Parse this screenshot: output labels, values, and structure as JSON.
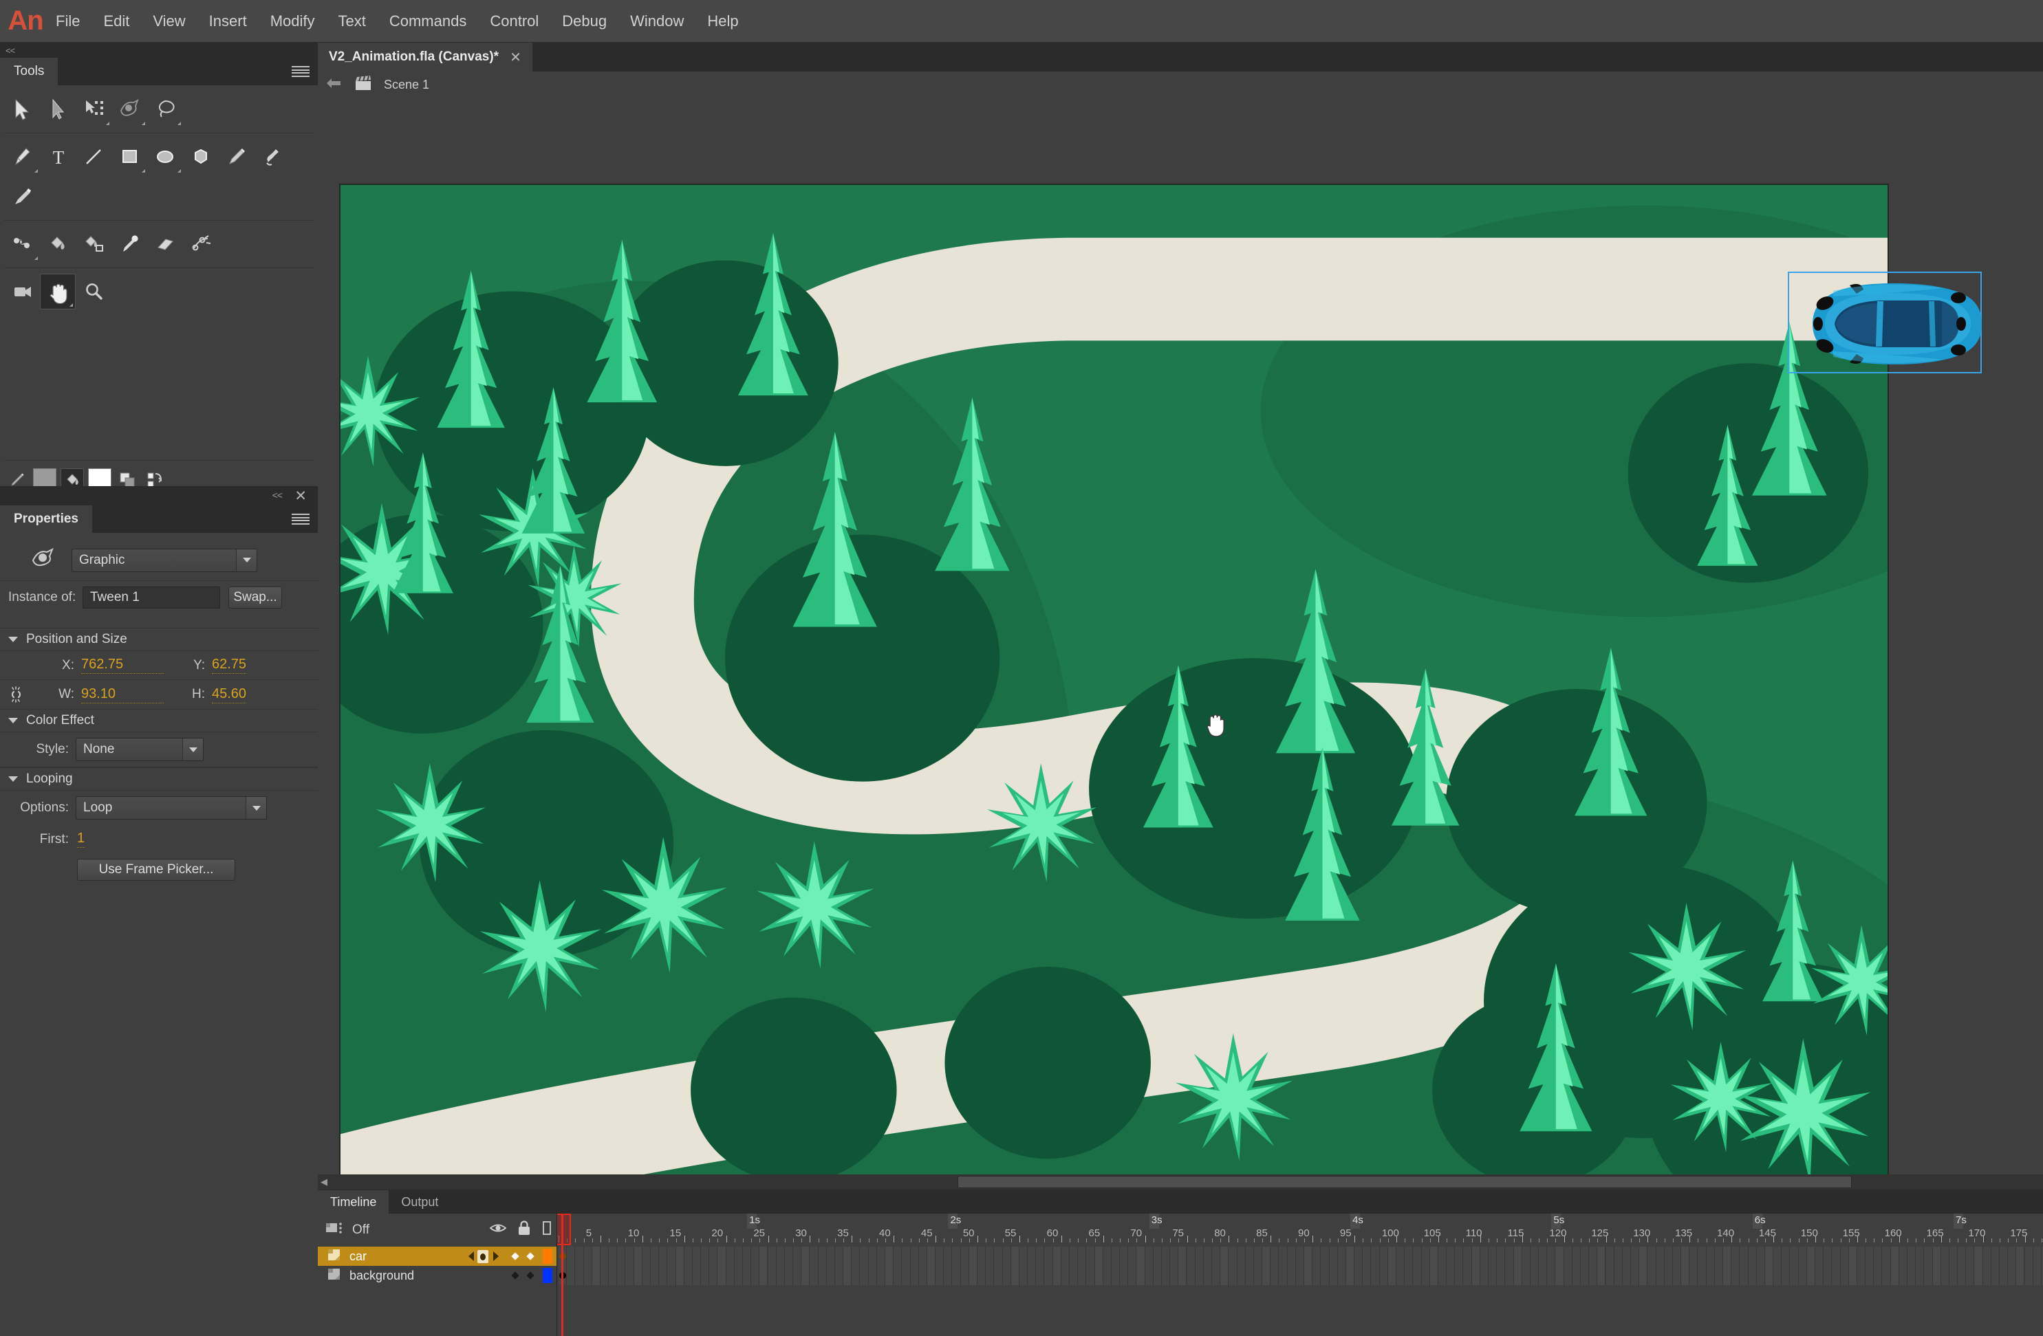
{
  "app": {
    "name": "Adobe Animate",
    "logo_text": "An",
    "accent_color": "#d7513a"
  },
  "menubar": {
    "items": [
      "File",
      "Edit",
      "View",
      "Insert",
      "Modify",
      "Text",
      "Commands",
      "Control",
      "Debug",
      "Window",
      "Help"
    ]
  },
  "tools_panel": {
    "title": "Tools",
    "collapse_glyph": "<<",
    "rows": [
      [
        {
          "name": "selection-tool",
          "has_corner": false,
          "active": false
        },
        {
          "name": "subselection-tool",
          "has_corner": false,
          "active": false
        },
        {
          "name": "free-transform-tool",
          "has_corner": true,
          "active": false
        },
        {
          "name": "gradient-transform-tool",
          "has_corner": true,
          "active": false
        },
        {
          "name": "lasso-tool",
          "has_corner": true,
          "active": false
        }
      ],
      [
        {
          "name": "pen-tool",
          "has_corner": true,
          "active": false
        },
        {
          "name": "text-tool",
          "has_corner": false,
          "active": false
        },
        {
          "name": "line-tool",
          "has_corner": false,
          "active": false
        },
        {
          "name": "rectangle-tool",
          "has_corner": true,
          "active": false
        },
        {
          "name": "oval-tool",
          "has_corner": true,
          "active": false
        },
        {
          "name": "polystar-tool",
          "has_corner": false,
          "active": false
        },
        {
          "name": "pencil-tool",
          "has_corner": false,
          "active": false
        },
        {
          "name": "brush-tool",
          "has_corner": false,
          "active": false
        }
      ],
      [
        {
          "name": "paint-brush-tool",
          "has_corner": false,
          "active": false
        }
      ],
      [
        {
          "name": "bone-tool",
          "has_corner": true,
          "active": false
        },
        {
          "name": "paint-bucket-tool",
          "has_corner": false,
          "active": false
        },
        {
          "name": "ink-bottle-tool",
          "has_corner": false,
          "active": false
        },
        {
          "name": "eyedropper-tool",
          "has_corner": false,
          "active": false
        },
        {
          "name": "eraser-tool",
          "has_corner": false,
          "active": false
        },
        {
          "name": "width-tool",
          "has_corner": false,
          "active": false
        }
      ],
      [
        {
          "name": "camera-tool",
          "has_corner": false,
          "active": false
        },
        {
          "name": "hand-tool",
          "has_corner": true,
          "active": true
        },
        {
          "name": "zoom-tool",
          "has_corner": false,
          "active": false
        }
      ]
    ],
    "colors": {
      "stroke_color": "#9b9b9b",
      "fill_color": "#ffffff",
      "stroke_icon": "pencil-stroke-icon",
      "fill_icon": "paint-bucket-fill-icon",
      "black-white-icon": "black-and-white-icon",
      "swap-icon": "swap-colors-icon"
    }
  },
  "properties_panel": {
    "title": "Properties",
    "collapse_glyph": "<<",
    "close_glyph": "✕",
    "symbol_icon": "graphic-symbol-icon",
    "symbol_type": "Graphic",
    "instance_of_label": "Instance of:",
    "instance_name": "Tween 1",
    "swap_button": "Swap...",
    "sections": {
      "position_and_size": {
        "title": "Position and Size",
        "x_label": "X:",
        "x_value": "762.75",
        "y_label": "Y:",
        "y_value": "62.75",
        "w_label": "W:",
        "w_value": "93.10",
        "h_label": "H:",
        "h_value": "45.60",
        "lock_icon": "broken-link-icon"
      },
      "color_effect": {
        "title": "Color Effect",
        "style_label": "Style:",
        "style_value": "None"
      },
      "looping": {
        "title": "Looping",
        "options_label": "Options:",
        "options_value": "Loop",
        "first_label": "First:",
        "first_value": "1",
        "frame_picker_button": "Use Frame Picker..."
      }
    },
    "value_color": "#d9a320"
  },
  "document": {
    "tab_title": "V2_Animation.fla (Canvas)*",
    "tab_close_glyph": "✕",
    "back_arrow_icon": "back-arrow-icon",
    "scene_icon": "scene-clapperboard-icon",
    "scene_name": "Scene 1"
  },
  "stage": {
    "background_green": "#1e7a4c",
    "shadow_green": "#17653f",
    "road_color": "#e8e4d5",
    "tree_dark": "#0f5537",
    "tree_mid": "#2bbd7e",
    "tree_light": "#6ff0b4",
    "car_body": "#1b9bd0",
    "car_window": "#11436b",
    "selection_color": "#3ba4e8",
    "cursor_icon": "hand-cursor",
    "transform_point_icon": "transform-point-icon",
    "scene_description": "Top-down winding S-curve road through a pine forest with a blue sports car"
  },
  "timeline": {
    "tabs": [
      {
        "label": "Timeline",
        "active": true
      },
      {
        "label": "Output",
        "active": false
      }
    ],
    "header": {
      "camera_icon": "camera-layer-icon",
      "camera_state": "Off",
      "eye_icon": "eye-icon",
      "lock_icon": "lock-icon",
      "outline_icon": "outline-square-icon"
    },
    "layers": [
      {
        "name": "car",
        "selected": true,
        "icon": "layer-folder-icon",
        "outline_color": "#ff7a00",
        "has_onion_markers": true,
        "keyframe_color": "#7a4a00"
      },
      {
        "name": "background",
        "selected": false,
        "icon": "layer-folder-icon",
        "outline_color": "#0033ff",
        "has_onion_markers": false,
        "keyframe_color": "#000000"
      }
    ],
    "ruler": {
      "frame_numbers": [
        1,
        5,
        10,
        15,
        20,
        25,
        30,
        35,
        40,
        45,
        50,
        55,
        60,
        65,
        70,
        75,
        80,
        85,
        90,
        95,
        100,
        105,
        110,
        115,
        120,
        125,
        130,
        135,
        140,
        145,
        150,
        155,
        160,
        165,
        170,
        175
      ],
      "second_markers": [
        "1s",
        "2s",
        "3s",
        "4s",
        "5s",
        "6s",
        "7s"
      ],
      "second_frames": [
        24,
        48,
        72,
        96,
        120,
        144,
        168
      ],
      "fps": 24,
      "playhead_frame": 1
    },
    "playhead_color": "#e02b20"
  }
}
